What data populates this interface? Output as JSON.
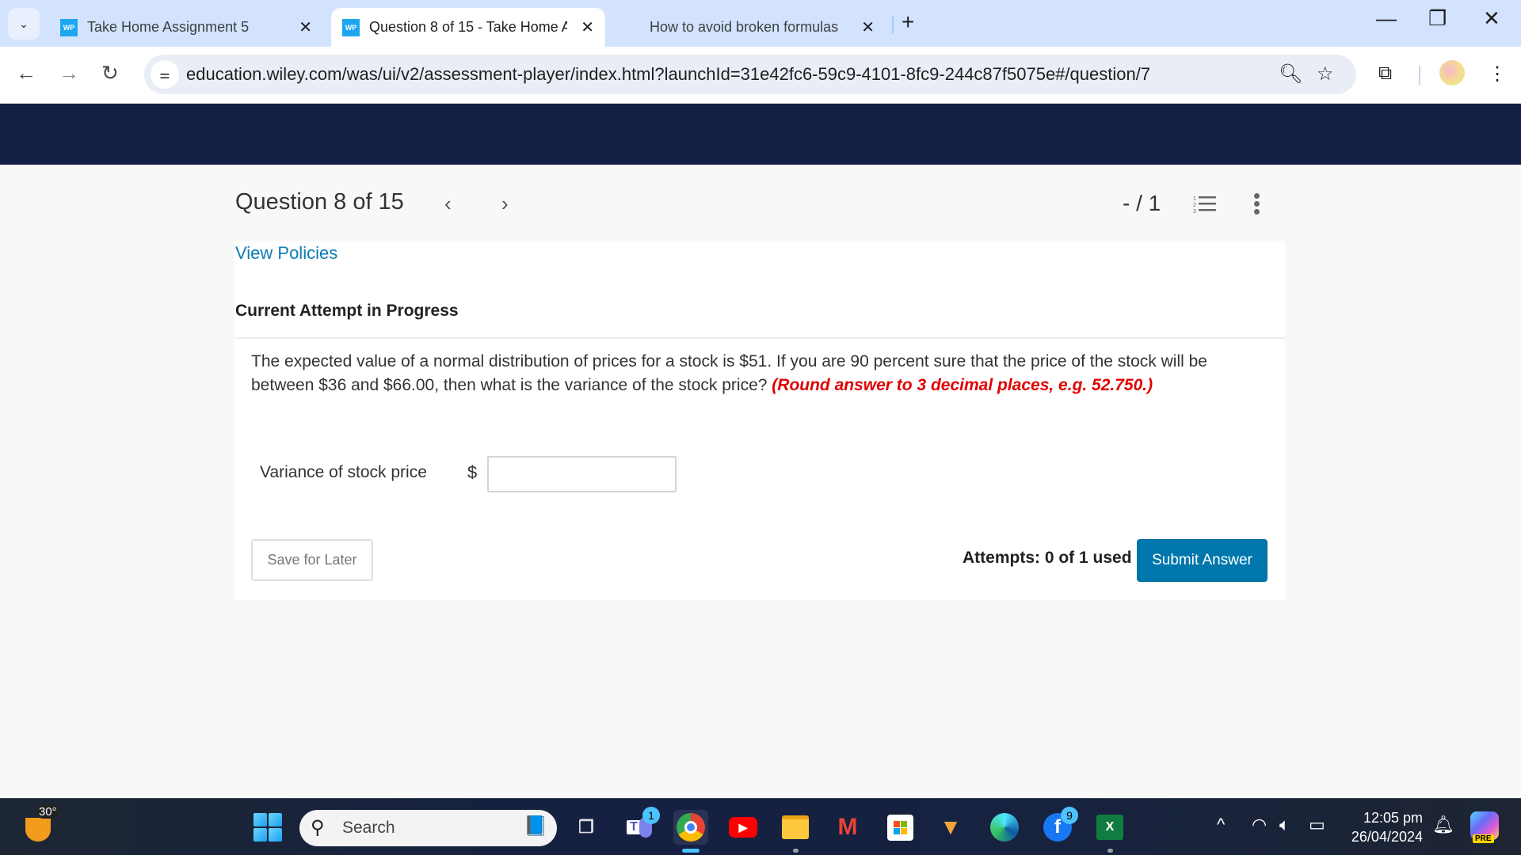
{
  "browser": {
    "tabs": [
      {
        "label": "Take Home Assignment 5",
        "favicon": "WP",
        "active": false
      },
      {
        "label": "Question 8 of 15 - Take Home A",
        "favicon": "WP",
        "active": true
      },
      {
        "label": "How to avoid broken formulas -",
        "favicon": "microsoft-logo",
        "active": false
      }
    ],
    "tab_list_icon": "chevron-down-icon",
    "new_tab_icon": "+",
    "url": "education.wiley.com/was/ui/v2/assessment-player/index.html?launchId=31e42fc6-59c9-4101-8fc9-244c87f5075e#/question/7",
    "window_controls": {
      "minimize": "—",
      "restore": "❐",
      "close": "✕"
    }
  },
  "question_header": {
    "title": "Question 8 of 15",
    "prev": "‹",
    "next": "›",
    "score": "- / 1"
  },
  "content": {
    "view_policies": "View Policies",
    "attempt_status": "Current Attempt in Progress",
    "question_text": "The expected value of a normal distribution of prices for a stock is $51. If you are 90 percent sure that the price of the stock will be between $36 and $66.00, then what is the variance of the stock price?",
    "question_hint": "(Round answer to 3 decimal places, e.g. 52.750.)",
    "field_label": "Variance of stock price",
    "currency_symbol": "$",
    "answer_value": "",
    "save_label": "Save for Later",
    "attempts_text": "Attempts: 0 of 1 used",
    "submit_label": "Submit Answer"
  },
  "colors": {
    "header_navy": "#131f44",
    "link_blue": "#0c7cb3",
    "submit_blue": "#0077ac",
    "hint_red": "#e00000"
  },
  "taskbar": {
    "weather_temp": "30°",
    "search_label": "Search",
    "apps": [
      {
        "name": "task-view",
        "badge": ""
      },
      {
        "name": "teams",
        "badge": "1"
      },
      {
        "name": "chrome",
        "badge": ""
      },
      {
        "name": "youtube",
        "badge": ""
      },
      {
        "name": "file-explorer",
        "badge": ""
      },
      {
        "name": "gmail",
        "badge": ""
      },
      {
        "name": "microsoft-store",
        "badge": ""
      },
      {
        "name": "app-v",
        "badge": ""
      },
      {
        "name": "edge",
        "badge": ""
      },
      {
        "name": "facebook",
        "badge": "9"
      },
      {
        "name": "excel",
        "badge": ""
      }
    ],
    "time": "12:05 pm",
    "date": "26/04/2024",
    "copilot_badge": "PRE"
  }
}
